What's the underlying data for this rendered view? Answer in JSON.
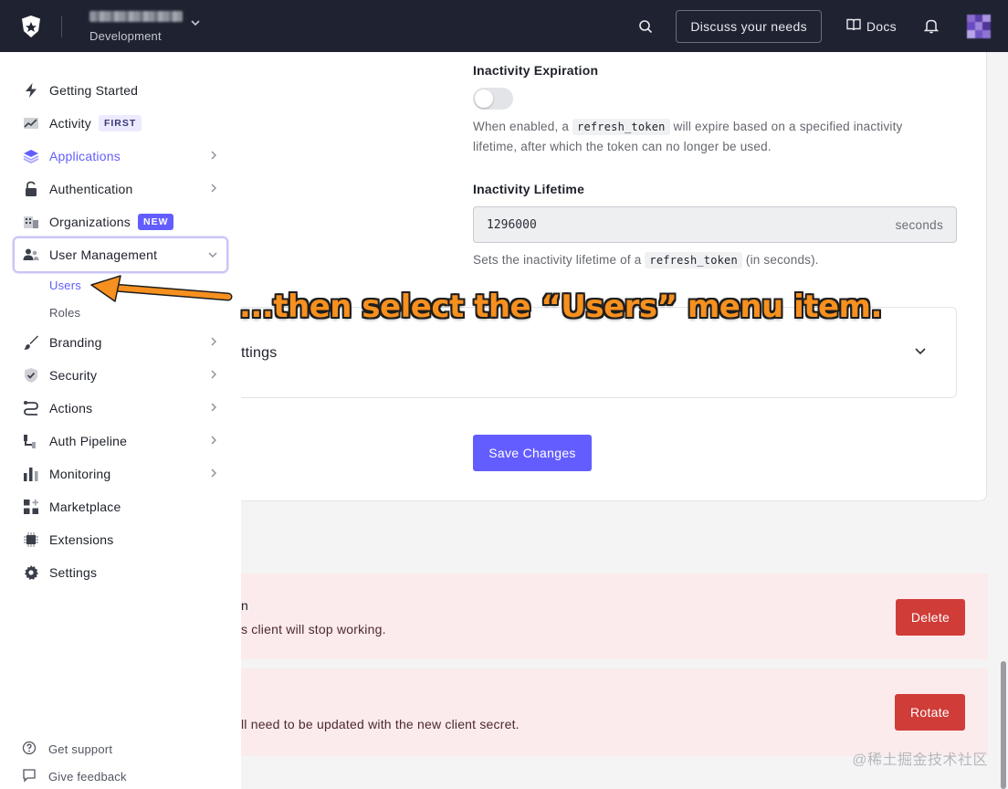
{
  "topbar": {
    "tenant_env": "Development",
    "discuss_label": "Discuss your needs",
    "docs_label": "Docs"
  },
  "sidebar": {
    "items": [
      {
        "label": "Getting Started",
        "icon": "lightning-icon"
      },
      {
        "label": "Activity",
        "icon": "activity-chart-icon",
        "badge": "FIRST"
      },
      {
        "label": "Applications",
        "icon": "layers-icon",
        "active": true
      },
      {
        "label": "Authentication",
        "icon": "lock-icon"
      },
      {
        "label": "Organizations",
        "icon": "building-icon",
        "badge": "NEW"
      },
      {
        "label": "User Management",
        "icon": "users-icon",
        "expanded": true
      },
      {
        "label": "Branding",
        "icon": "brush-icon"
      },
      {
        "label": "Security",
        "icon": "shield-icon"
      },
      {
        "label": "Actions",
        "icon": "actions-flow-icon"
      },
      {
        "label": "Auth Pipeline",
        "icon": "pipeline-icon"
      },
      {
        "label": "Monitoring",
        "icon": "bar-chart-icon"
      },
      {
        "label": "Marketplace",
        "icon": "grid-plus-icon"
      },
      {
        "label": "Extensions",
        "icon": "chip-icon"
      },
      {
        "label": "Settings",
        "icon": "gear-icon"
      }
    ],
    "sub_items": {
      "users": "Users",
      "roles": "Roles"
    },
    "footer": {
      "support": "Get support",
      "feedback": "Give feedback"
    }
  },
  "main": {
    "inactivity_expiration": {
      "label": "Inactivity Expiration",
      "enabled": false,
      "help_pre": "When enabled, a",
      "help_code": "refresh_token",
      "help_post": "will expire based on a specified inactivity lifetime, after which the token can no longer be used."
    },
    "inactivity_lifetime": {
      "label": "Inactivity Lifetime",
      "value": "1296000",
      "unit": "seconds",
      "help_pre": "Sets the inactivity lifetime of a",
      "help_code": "refresh_token",
      "help_post": "(in seconds)."
    },
    "accordion_label": "ttings",
    "save_label": "Save Changes"
  },
  "danger_zone": {
    "delete": {
      "title": "n",
      "text": "s client will stop working.",
      "button": "Delete"
    },
    "rotate": {
      "text": "ll need to be updated with the new client secret.",
      "button": "Rotate"
    }
  },
  "annotation": {
    "text": "...then select the “Users” menu item.",
    "color": "#f7901e"
  },
  "watermark": "@稀土掘金技术社区",
  "colors": {
    "accent": "#635dff",
    "topbar": "#1f2331",
    "danger": "#d03c38",
    "danger_bg": "#fcebec"
  }
}
